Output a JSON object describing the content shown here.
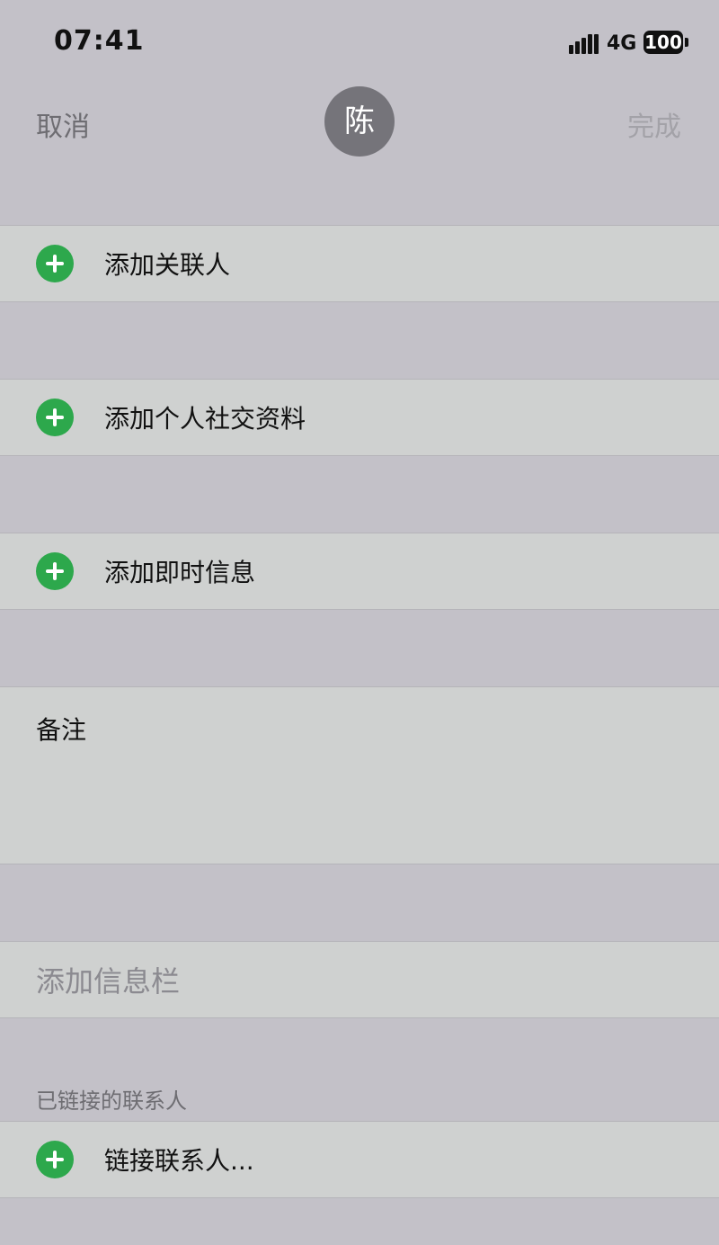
{
  "status_bar": {
    "time": "07:41",
    "network": "4G",
    "battery": "100"
  },
  "nav": {
    "cancel_label": "取消",
    "avatar_initial": "陈",
    "done_label": "完成"
  },
  "rows": {
    "add_related": "添加关联人",
    "add_social": "添加个人社交资料",
    "add_im": "添加即时信息",
    "notes": "备注",
    "add_field": "添加信息栏",
    "linked_header": "已链接的联系人",
    "link_contact": "链接联系人..."
  },
  "colors": {
    "accent_green": "#2da84c",
    "background": "#c3c1c8",
    "cell": "#cfd1d0"
  }
}
